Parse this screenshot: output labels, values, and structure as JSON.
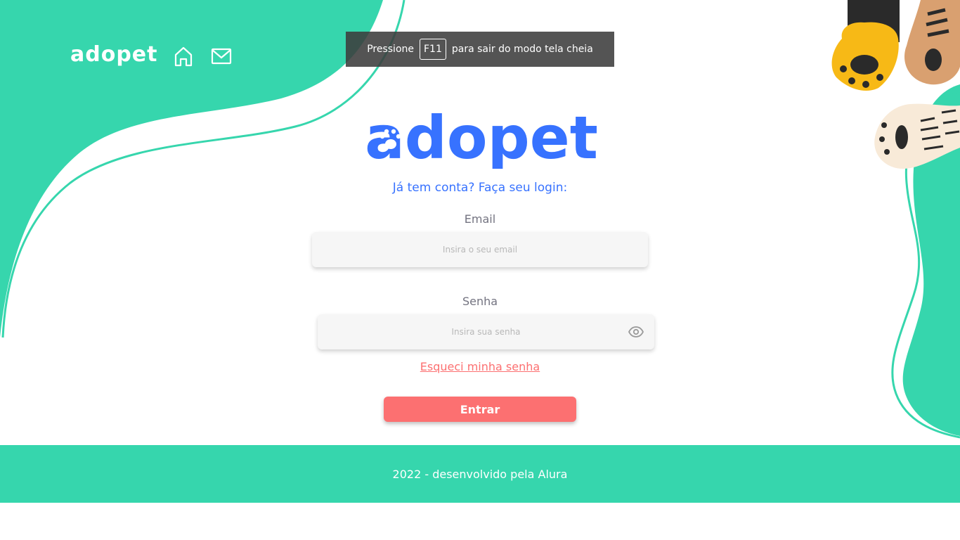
{
  "colors": {
    "accent": "#36d6ad",
    "brand_blue": "#3772ff",
    "coral": "#fc7071"
  },
  "header": {
    "logo": "adopet",
    "icons": [
      "home-icon",
      "mail-icon"
    ]
  },
  "fullscreen_banner": {
    "before": "Pressione",
    "key": "F11",
    "after": "para sair do modo tela cheia"
  },
  "main": {
    "logo": "adopet",
    "subtitle": "Já tem conta? Faça seu login:"
  },
  "form": {
    "email_label": "Email",
    "email_placeholder": "Insira o seu email",
    "email_value": "",
    "password_label": "Senha",
    "password_placeholder": "Insira sua senha",
    "password_value": "",
    "password_icon": "eye-icon",
    "forgot_link": "Esqueci minha senha",
    "submit_label": "Entrar"
  },
  "footer": {
    "text": "2022 - desenvolvido pela Alura"
  }
}
